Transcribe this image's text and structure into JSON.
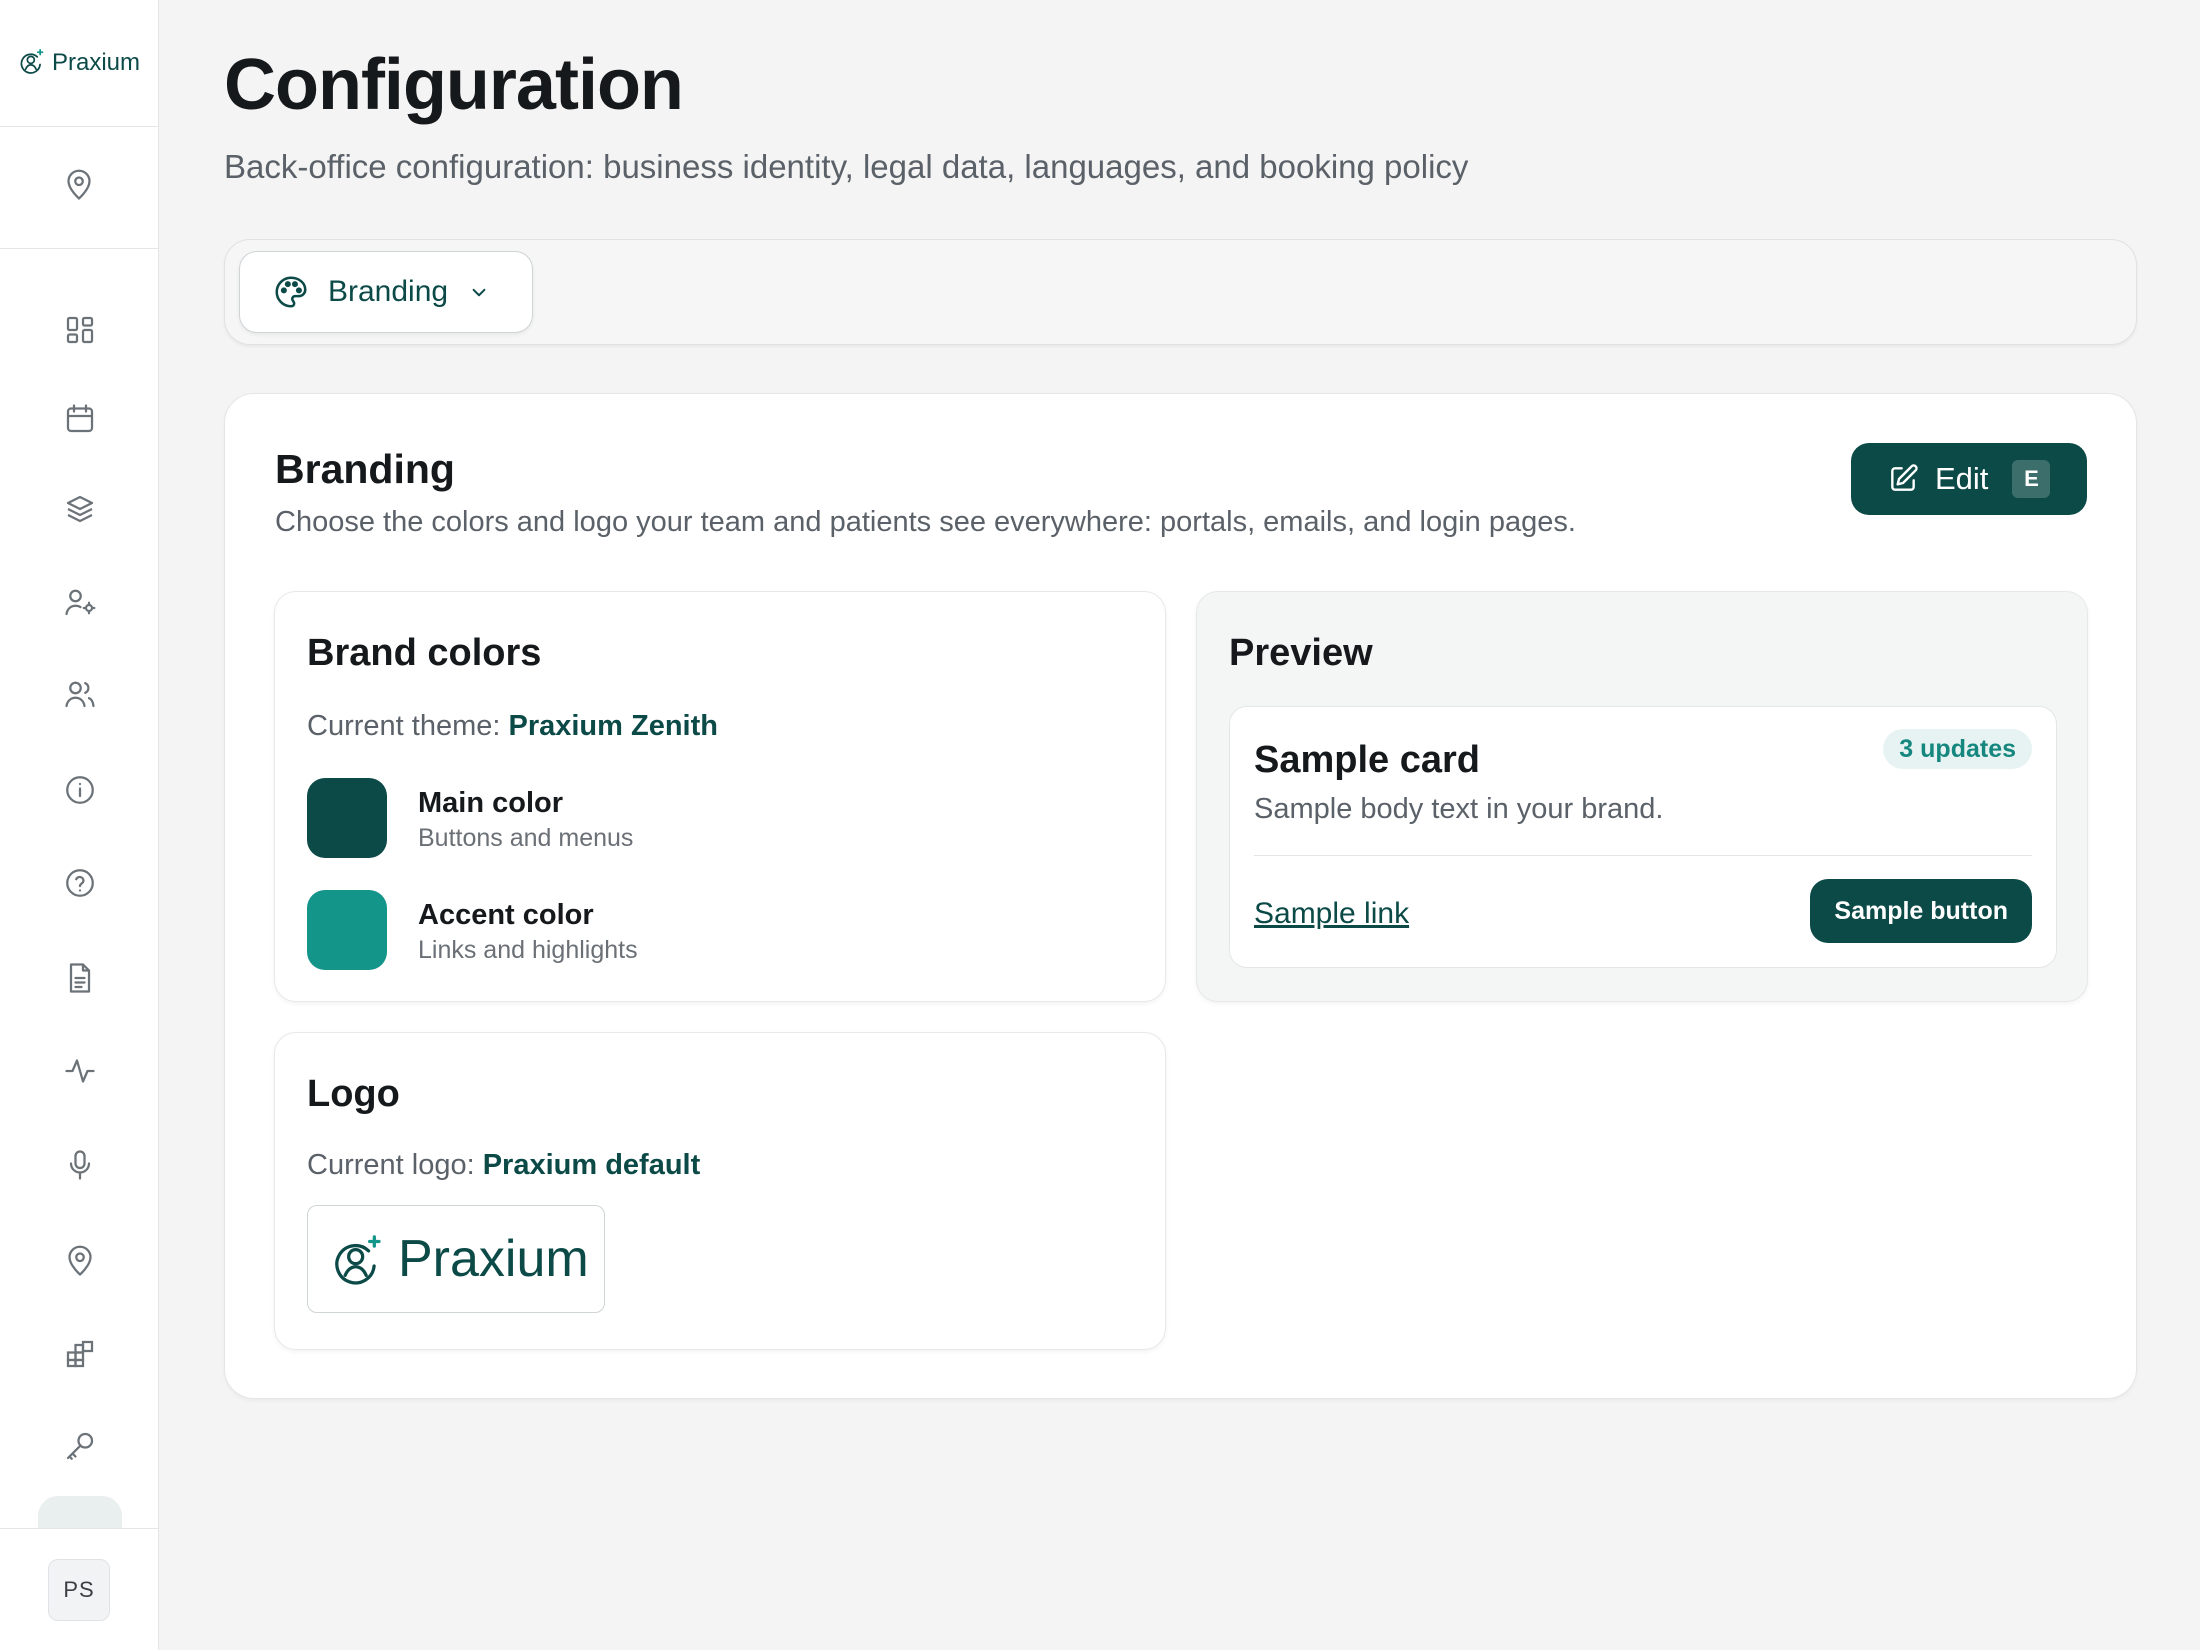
{
  "app": {
    "brand_name": "Praxium",
    "user_initials": "PS"
  },
  "colors": {
    "main": "#0b4a47",
    "accent": "#14958a"
  },
  "sidebar": {
    "location_icon": "map-pin-icon",
    "items": [
      {
        "icon": "dashboard-icon"
      },
      {
        "icon": "calendar-icon"
      },
      {
        "icon": "layers-icon"
      },
      {
        "icon": "user-settings-icon"
      },
      {
        "icon": "users-icon"
      },
      {
        "icon": "info-icon"
      },
      {
        "icon": "help-icon"
      },
      {
        "icon": "document-icon"
      },
      {
        "icon": "activity-icon"
      },
      {
        "icon": "microphone-icon"
      },
      {
        "icon": "map-pin-icon"
      },
      {
        "icon": "integrations-icon"
      },
      {
        "icon": "key-icon"
      },
      {
        "icon": "settings-icon",
        "active": true
      }
    ]
  },
  "page": {
    "title": "Configuration",
    "subtitle": "Back-office configuration: business identity, legal data, languages, and booking policy"
  },
  "section_select": {
    "selected": "Branding"
  },
  "branding": {
    "title": "Branding",
    "description": "Choose the colors and logo your team and patients see everywhere: portals, emails, and login pages.",
    "edit_label": "Edit",
    "edit_shortcut": "E",
    "brand_colors": {
      "title": "Brand colors",
      "theme_label": "Current theme:",
      "theme_value": "Praxium Zenith",
      "main": {
        "name": "Main color",
        "desc": "Buttons and menus"
      },
      "accent": {
        "name": "Accent color",
        "desc": "Links and highlights"
      }
    },
    "preview": {
      "title": "Preview",
      "card_title": "Sample card",
      "card_body": "Sample body text in your brand.",
      "badge": "3 updates",
      "link": "Sample link",
      "button": "Sample button"
    },
    "logo": {
      "title": "Logo",
      "current_label": "Current logo:",
      "current_value": "Praxium default",
      "logo_text": "Praxium"
    }
  }
}
